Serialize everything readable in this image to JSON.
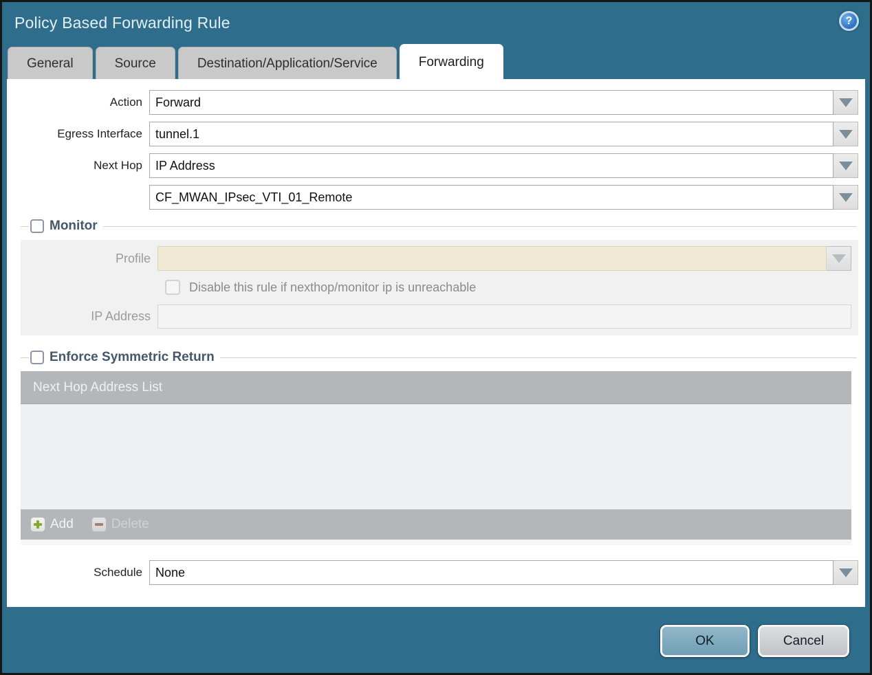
{
  "dialog": {
    "title": "Policy Based Forwarding Rule",
    "help_glyph": "?"
  },
  "tabs": [
    {
      "label": "General",
      "active": false
    },
    {
      "label": "Source",
      "active": false
    },
    {
      "label": "Destination/Application/Service",
      "active": false
    },
    {
      "label": "Forwarding",
      "active": true
    }
  ],
  "form": {
    "action": {
      "label": "Action",
      "value": "Forward"
    },
    "egress_interface": {
      "label": "Egress Interface",
      "value": "tunnel.1"
    },
    "next_hop": {
      "label": "Next Hop",
      "value": "IP Address"
    },
    "next_hop_address": {
      "value": "CF_MWAN_IPsec_VTI_01_Remote"
    },
    "schedule": {
      "label": "Schedule",
      "value": "None"
    }
  },
  "monitor": {
    "legend": "Monitor",
    "checked": false,
    "profile": {
      "label": "Profile",
      "value": ""
    },
    "disable_rule": {
      "label": "Disable this rule if nexthop/monitor ip is unreachable",
      "checked": false
    },
    "ip_address": {
      "label": "IP Address",
      "value": ""
    }
  },
  "symmetric_return": {
    "legend": "Enforce Symmetric Return",
    "checked": false,
    "table": {
      "header": "Next Hop Address List",
      "rows": []
    },
    "add_label": "Add",
    "delete_label": "Delete"
  },
  "footer": {
    "ok_label": "OK",
    "cancel_label": "Cancel"
  },
  "colors": {
    "chrome_teal": "#2e6d8c",
    "tab_inactive": "#c9c9c9",
    "table_gray": "#b3b7ba",
    "disabled_field_cream": "#f0e9d3",
    "legend_text": "#44576b",
    "ok_button": "#7aa6bb",
    "add_plus_green": "#87a930",
    "delete_minus_red": "#a56a5c"
  }
}
